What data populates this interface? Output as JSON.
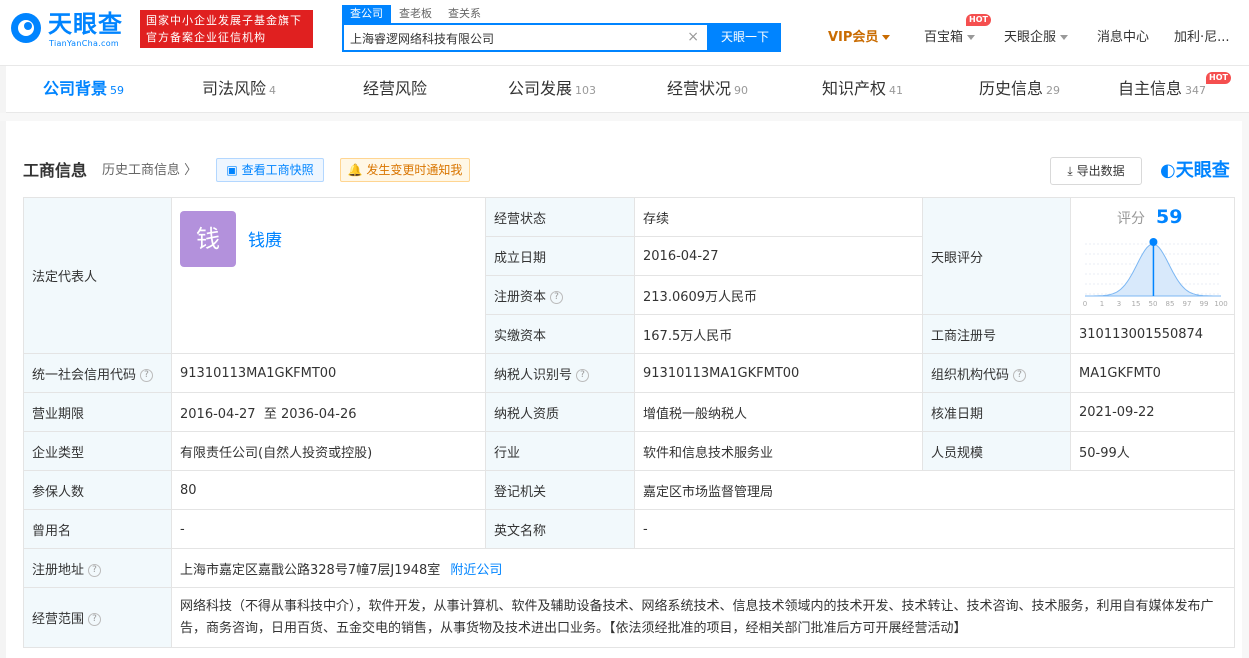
{
  "header": {
    "logo_cn": "天眼查",
    "logo_en": "TianYanCha.com",
    "fund_line1": "国家中小企业发展子基金旗下",
    "fund_line2": "官方备案企业征信机构",
    "search_tabs": [
      "查公司",
      "查老板",
      "查关系"
    ],
    "search_value": "上海睿逻网络科技有限公司",
    "search_button": "天眼一下",
    "nav": {
      "vip": "VIP会员",
      "treasure": "百宝箱",
      "hot": "HOT",
      "enterprise": "天眼企服",
      "messages": "消息中心",
      "user": "加利·尼..."
    }
  },
  "module_tabs": [
    {
      "label": "公司背景",
      "count": "59"
    },
    {
      "label": "司法风险",
      "count": "4"
    },
    {
      "label": "经营风险",
      "count": ""
    },
    {
      "label": "公司发展",
      "count": "103"
    },
    {
      "label": "经营状况",
      "count": "90"
    },
    {
      "label": "知识产权",
      "count": "41"
    },
    {
      "label": "历史信息",
      "count": "29"
    },
    {
      "label": "自主信息",
      "count": "347",
      "badge": "HOT"
    }
  ],
  "section": {
    "title": "工商信息",
    "history": "历史工商信息",
    "snapshot_btn": "查看工商快照",
    "notify_btn": "发生变更时通知我",
    "export_btn": "导出数据",
    "watermark": "天眼查"
  },
  "business_info": {
    "legal_rep_label": "法定代表人",
    "legal_rep_avatar": "钱",
    "legal_rep_name": "钱赓",
    "status_label": "经营状态",
    "status": "存续",
    "founded_label": "成立日期",
    "founded": "2016-04-27",
    "reg_capital_label": "注册资本",
    "reg_capital": "213.0609万人民币",
    "paid_capital_label": "实缴资本",
    "paid_capital": "167.5万人民币",
    "score_label": "天眼评分",
    "score_title": "评分",
    "score": 59,
    "score_ticks": [
      "0",
      "1",
      "3",
      "15",
      "50",
      "85",
      "97",
      "99",
      "100"
    ],
    "reg_no_label": "工商注册号",
    "reg_no": "310113001550874",
    "credit_code_label": "统一社会信用代码",
    "credit_code": "91310113MA1GKFMT00",
    "taxpayer_id_label": "纳税人识别号",
    "taxpayer_id": "91310113MA1GKFMT00",
    "org_code_label": "组织机构代码",
    "org_code": "MA1GKFMT0",
    "term_label": "营业期限",
    "term": "2016-04-27  至 2036-04-26",
    "taxpayer_qual_label": "纳税人资质",
    "taxpayer_qual": "增值税一般纳税人",
    "approval_label": "核准日期",
    "approval_date": "2021-09-22",
    "type_label": "企业类型",
    "type": "有限责任公司(自然人投资或控股)",
    "industry_label": "行业",
    "industry": "软件和信息技术服务业",
    "staff_label": "人员规模",
    "staff": "50-99人",
    "insured_label": "参保人数",
    "insured": "80",
    "authority_label": "登记机关",
    "authority": "嘉定区市场监督管理局",
    "former_name_label": "曾用名",
    "former_name": "-",
    "english_name_label": "英文名称",
    "english_name": "-",
    "address_label": "注册地址",
    "address": "上海市嘉定区嘉戬公路328号7幢7层J1948室",
    "nearby_link": "附近公司",
    "scope_label": "经营范围",
    "scope": "网络科技（不得从事科技中介），软件开发，从事计算机、软件及辅助设备技术、网络系统技术、信息技术领域内的技术开发、技术转让、技术咨询、技术服务，利用自有媒体发布广告，商务咨询，日用百货、五金交电的销售，从事货物及技术进出口业务。【依法须经批准的项目，经相关部门批准后方可开展经营活动】"
  },
  "colors": {
    "brand": "#0084ff",
    "red": "#e02020",
    "label_bg": "#f2f9fc",
    "avatar": "#b391dc"
  }
}
